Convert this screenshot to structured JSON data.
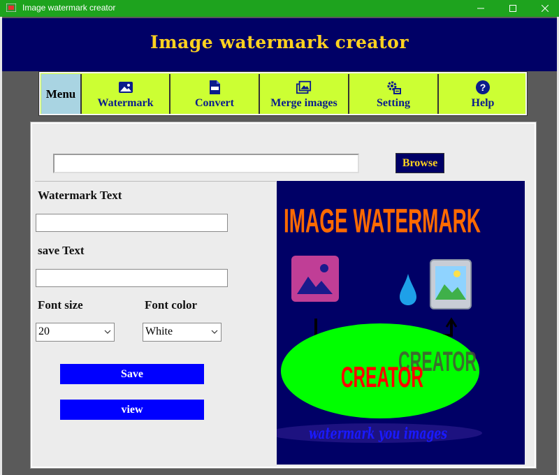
{
  "window": {
    "title": "Image watermark creator",
    "controls": [
      "minimize",
      "maximize",
      "close"
    ]
  },
  "header": {
    "app_title": "Image watermark creator",
    "colors": {
      "background": "#000066",
      "title": "#ffd21f"
    }
  },
  "menu": {
    "label": "Menu",
    "items": [
      {
        "label": "Watermark",
        "icon": "image-icon"
      },
      {
        "label": "Convert",
        "icon": "png-file-icon"
      },
      {
        "label": "Merge images",
        "icon": "images-icon"
      },
      {
        "label": "Setting",
        "icon": "gear-icon"
      },
      {
        "label": "Help",
        "icon": "help-icon"
      }
    ],
    "colors": {
      "background": "#ccff33",
      "text": "#0b1c8c"
    }
  },
  "file": {
    "path_value": "",
    "browse_label": "Browse"
  },
  "form": {
    "watermark_text_label": "Watermark Text",
    "watermark_text_value": "",
    "save_text_label": "save Text",
    "save_text_value": "",
    "font_size_label": "Font size",
    "font_size_value": "20",
    "font_color_label": "Font color",
    "font_color_value": "White",
    "save_label": "Save",
    "view_label": "view"
  },
  "preview": {
    "logo_lettering": {
      "headline": "IMAGE WATERMARK",
      "center": "CREATOR",
      "center_shadow": "CREATOR",
      "tagline": "watermark you images"
    },
    "colors": {
      "background": "#000066",
      "headline": "#ff6a00",
      "ellipse": "#00ff00",
      "center": "#ff0000",
      "tagline": "#1a1aff"
    }
  }
}
